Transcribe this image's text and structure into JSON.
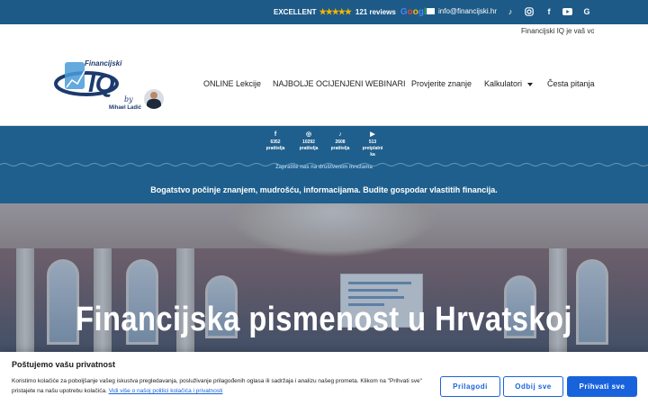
{
  "topbar": {
    "rating_label": "EXCELLENT",
    "stars": "★★★★★",
    "reviews": "121 reviews",
    "google_word": [
      "G",
      "o",
      "o",
      "g",
      "l",
      "e"
    ],
    "email": "info@financijski.hr",
    "social_icons": [
      "tiktok-icon",
      "instagram-icon",
      "facebook-icon",
      "youtube-icon",
      "google-icon"
    ]
  },
  "header": {
    "ticker": "Financijski IQ je vaš vodič",
    "logo": {
      "brand_top": "Financijski",
      "brand_main": "IQ",
      "by": "by",
      "author": "Mihael Ladić"
    },
    "nav": [
      {
        "label": "ONLINE Lekcije"
      },
      {
        "label": "NAJBOLJE OCIJENJENI WEBINARI"
      },
      {
        "label": "Provjerite znanje"
      },
      {
        "label": "Kalkulatori"
      },
      {
        "label": "Česta pitanja"
      }
    ]
  },
  "band": {
    "stats": [
      {
        "icon": "facebook-icon",
        "glyph": "f",
        "line1": "6352",
        "line2": "pratitelja"
      },
      {
        "icon": "instagram-icon",
        "glyph": "◎",
        "line1": "10292",
        "line2": "pratitelja"
      },
      {
        "icon": "tiktok-icon",
        "glyph": "♪",
        "line1": "2608",
        "line2": "pratitelja"
      },
      {
        "icon": "youtube-icon",
        "glyph": "▶",
        "line1": "513",
        "line2": "pretplatni",
        "line3": "ka"
      }
    ],
    "follow_text": "Zapratite nas na društvenim mrežama",
    "tagline": "Bogatstvo počinje znanjem, mudrošću, informacijama. Budite gospodar vlastitih financija."
  },
  "hero": {
    "title": "Financijska pismenost u Hrvatskoj"
  },
  "cookie": {
    "title": "Poštujemo vašu privatnost",
    "text": "Koristimo kolačiće za poboljšanje vašeg iskustva pregledavanja, posluživanje prilagođenih oglasa ili sadržaja i analizu našeg prometa. Klikom na \"Prihvati sve\" pristajete na našu upotrebu kolačića.",
    "link": "Vidi više o našoj politici kolačića i privatnosti",
    "buttons": {
      "customize": "Prilagodi",
      "reject": "Odbij sve",
      "accept": "Prihvati sve"
    },
    "accent": "#1863dc"
  },
  "colors": {
    "topbar": "#1d5a87",
    "band": "#1f5f8d"
  }
}
